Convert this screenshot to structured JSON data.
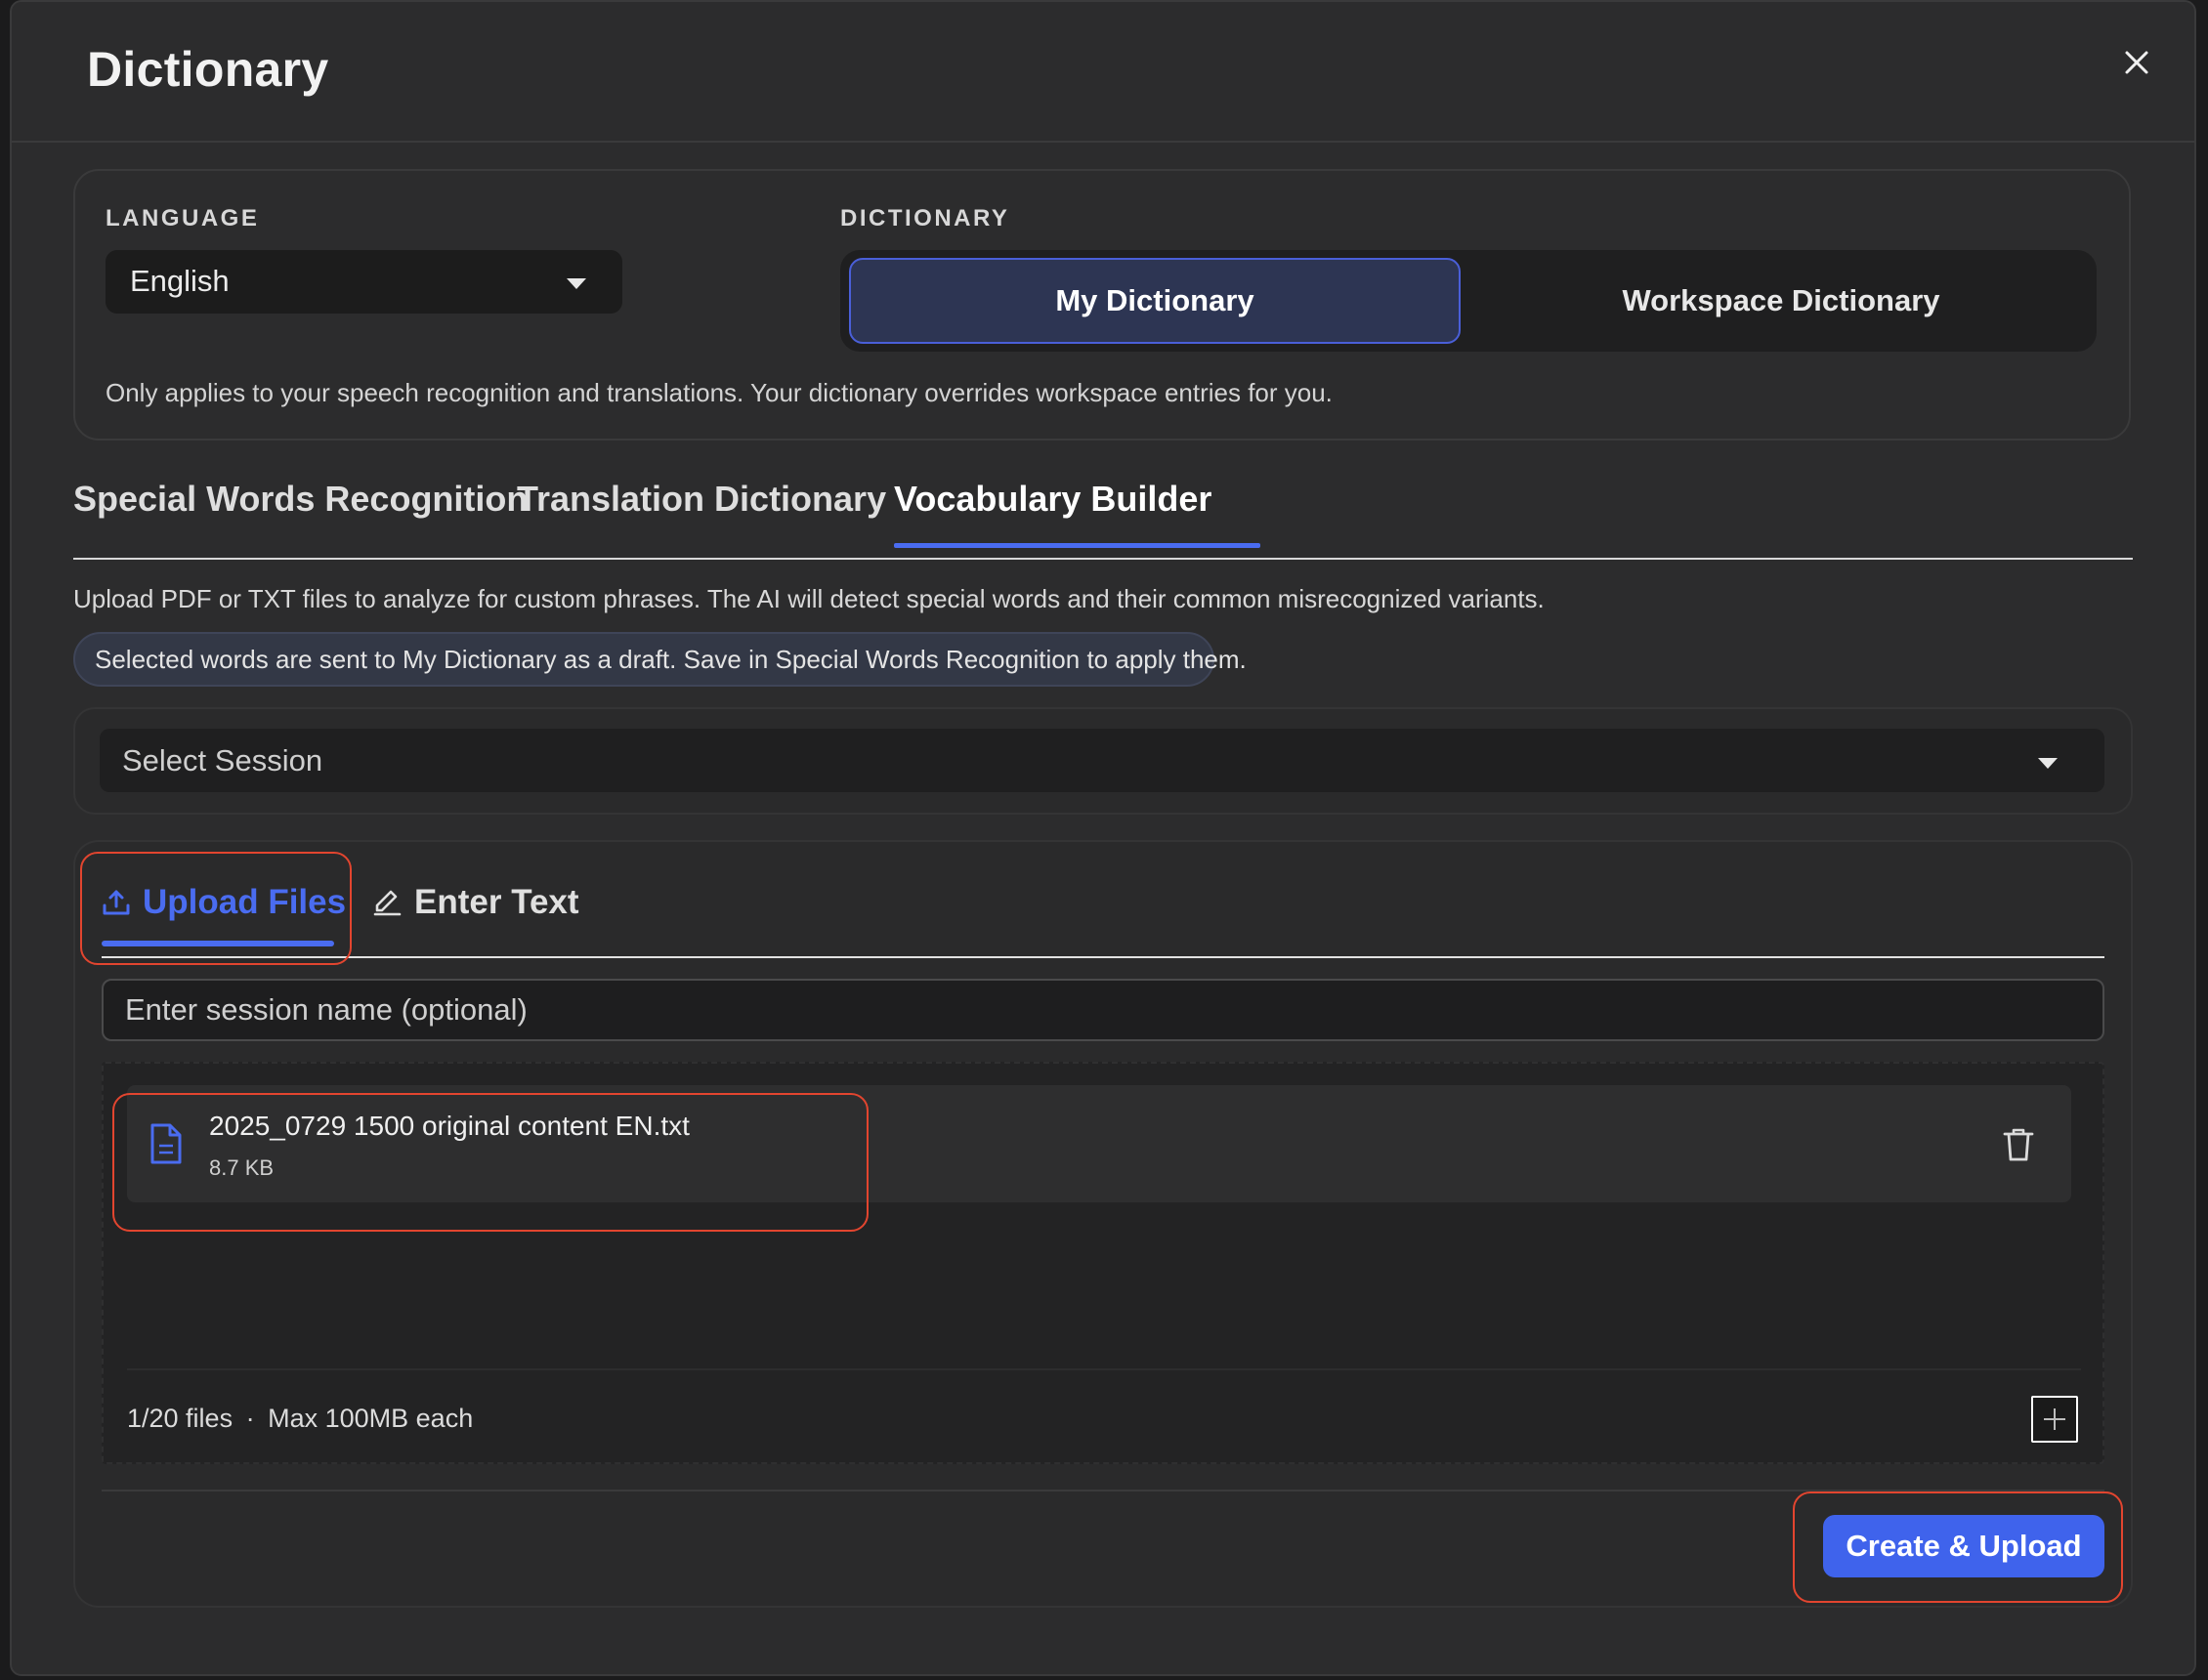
{
  "dialog": {
    "title": "Dictionary"
  },
  "settings": {
    "language_label": "LANGUAGE",
    "language_value": "English",
    "dictionary_label": "DICTIONARY",
    "dictionary_options": [
      "My Dictionary",
      "Workspace Dictionary"
    ],
    "dictionary_selected": "My Dictionary",
    "note": "Only applies to your speech recognition and translations. Your dictionary overrides workspace entries for you."
  },
  "tabs": {
    "items": [
      "Special Words Recognition",
      "Translation Dictionary",
      "Vocabulary Builder"
    ],
    "active": "Vocabulary Builder"
  },
  "vocab_builder": {
    "description": "Upload PDF or TXT files to analyze for custom phrases. The AI will detect special words and their common misrecognized variants.",
    "info_chip": "Selected words are sent to My Dictionary as a draft. Save in Special Words Recognition to apply them.",
    "session_select_placeholder": "Select Session",
    "sub_tabs": [
      "Upload Files",
      "Enter Text"
    ],
    "sub_tab_active": "Upload Files",
    "session_name_placeholder": "Enter session name (optional)",
    "files": [
      {
        "name": "2025_0729 1500 original content EN.txt",
        "size": "8.7 KB"
      }
    ],
    "files_count": "1/20 files",
    "files_limit": "Max 100MB each",
    "files_count_separator": "·",
    "primary_button": "Create & Upload"
  },
  "colors": {
    "accent": "#4a6cf0",
    "primary_button": "#3f63ec",
    "highlight": "#e2452f",
    "background": "#2c2c2d"
  },
  "icons": {
    "close": "close-icon",
    "language_caret": "chevron-down-icon",
    "session_caret": "chevron-down-icon",
    "upload": "upload-icon",
    "edit": "pencil-icon",
    "file": "document-icon",
    "delete": "trash-icon",
    "add": "plus-icon"
  }
}
